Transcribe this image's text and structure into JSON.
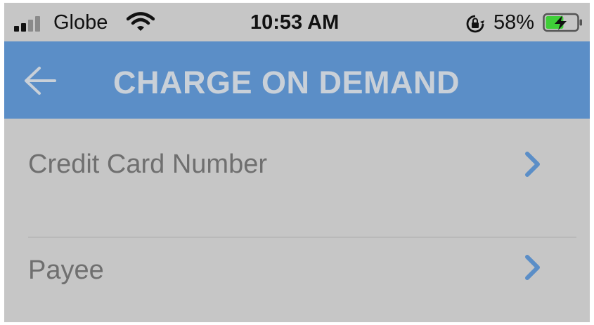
{
  "status_bar": {
    "carrier": "Globe",
    "time": "10:53 AM",
    "battery_percent": "58%",
    "battery_level": 0.58,
    "battery_charging": true,
    "signal_bars_filled": 2,
    "signal_bars_total": 4,
    "icons": [
      "signal-icon",
      "wifi-icon",
      "orientation-lock-icon",
      "battery-icon"
    ]
  },
  "header": {
    "title": "CHARGE ON DEMAND",
    "back_icon": "back-arrow-icon",
    "background": "#5b8ec7"
  },
  "rows": [
    {
      "label": "Credit Card Number",
      "icon": "chevron-right-icon"
    },
    {
      "label": "Payee",
      "icon": "chevron-right-icon"
    }
  ],
  "colors": {
    "screen_background": "#c6c6c6",
    "accent": "#5b8ec7",
    "row_text": "#6f6f6f",
    "battery_fill": "#3fce38"
  }
}
